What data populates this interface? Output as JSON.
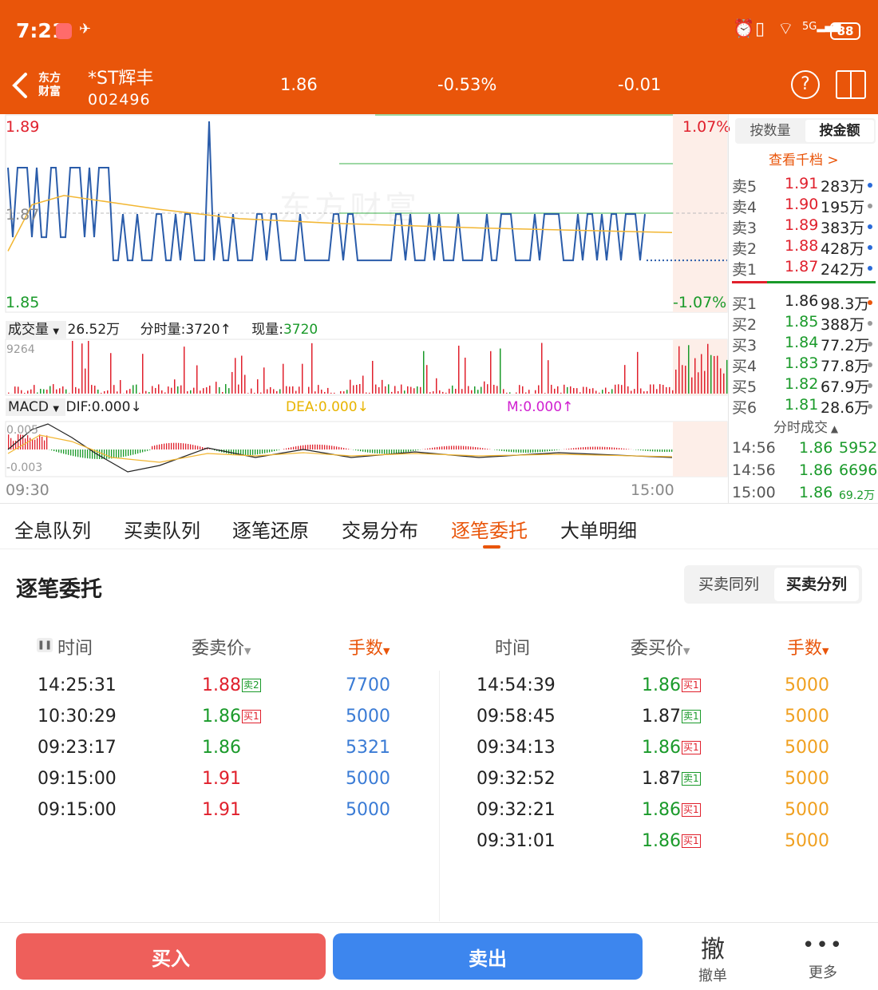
{
  "status_bar": {
    "time": "7:21",
    "battery": "88",
    "signal_label": "5G"
  },
  "header": {
    "logo_line1": "东方",
    "logo_line2": "财富",
    "stock_name": "*ST辉丰",
    "stock_code": "002496",
    "price": "1.86",
    "change_pct": "-0.53%",
    "change": "-0.01"
  },
  "chart": {
    "price_high": "1.89",
    "price_mid": "1.87",
    "price_low": "1.85",
    "pct_high": "1.07%",
    "pct_low": "-1.07%",
    "watermark": "东方财富",
    "volume_selector": "成交量",
    "volume_total": "26.52万",
    "period_volume_label": "分时量:3720",
    "current_volume_label": "现量:",
    "current_volume_value": "3720",
    "volume_axis_max": "9264",
    "macd_selector": "MACD",
    "dif": "DIF:0.000",
    "dea": "DEA:0.000",
    "m": "M:0.000",
    "macd_axis_top": "0.005",
    "macd_axis_bottom": "-0.003",
    "time_start": "09:30",
    "time_end": "15:00",
    "colors": {
      "price_line": "#2a5caa",
      "avg_line": "#f2b632",
      "up": "#e0202c",
      "down": "#1a9a2a"
    }
  },
  "order_book": {
    "toggle_qty": "按数量",
    "toggle_amount": "按金额",
    "view_depth": "查看千档 >",
    "asks": [
      {
        "label": "卖5",
        "price": "1.91",
        "amount": "283万",
        "dot": "#2a6ad8"
      },
      {
        "label": "卖4",
        "price": "1.90",
        "amount": "195万",
        "dot": "#999999"
      },
      {
        "label": "卖3",
        "price": "1.89",
        "amount": "383万",
        "dot": "#2a6ad8"
      },
      {
        "label": "卖2",
        "price": "1.88",
        "amount": "428万",
        "dot": "#2a6ad8"
      },
      {
        "label": "卖1",
        "price": "1.87",
        "amount": "242万",
        "dot": "#2a6ad8"
      }
    ],
    "bids": [
      {
        "label": "买1",
        "price": "1.86",
        "amount": "98.3万",
        "dot": "#e9550a"
      },
      {
        "label": "买2",
        "price": "1.85",
        "amount": "388万",
        "dot": "#999999"
      },
      {
        "label": "买3",
        "price": "1.84",
        "amount": "77.2万",
        "dot": "#999999"
      },
      {
        "label": "买4",
        "price": "1.83",
        "amount": "77.8万",
        "dot": "#999999"
      },
      {
        "label": "买5",
        "price": "1.82",
        "amount": "67.9万",
        "dot": "#999999"
      },
      {
        "label": "买6",
        "price": "1.81",
        "amount": "28.6万",
        "dot": "#999999"
      }
    ],
    "ticks_header": "分时成交",
    "ticks": [
      {
        "time": "14:56",
        "price": "1.86",
        "volume": "5952"
      },
      {
        "time": "14:56",
        "price": "1.86",
        "volume": "6696"
      },
      {
        "time": "15:00",
        "price": "1.86",
        "volume": "69.2万"
      }
    ]
  },
  "tabs": [
    "全息队列",
    "买卖队列",
    "逐笔还原",
    "交易分布",
    "逐笔委托",
    "大单明细"
  ],
  "active_tab": 4,
  "detail": {
    "title": "逐笔委托",
    "seg_same": "买卖同列",
    "seg_split": "买卖分列",
    "sell_headers": {
      "time": "时间",
      "price": "委卖价",
      "qty": "手数"
    },
    "buy_headers": {
      "time": "时间",
      "price": "委买价",
      "qty": "手数"
    },
    "sell_rows": [
      {
        "time": "14:25:31",
        "price": "1.88",
        "tag": "卖2",
        "qty": "7700",
        "color": "#e0202c",
        "tag_color": "#1a9a2a"
      },
      {
        "time": "10:30:29",
        "price": "1.86",
        "tag": "买1",
        "qty": "5000",
        "color": "#1a9a2a",
        "tag_color": "#e0202c"
      },
      {
        "time": "09:23:17",
        "price": "1.86",
        "tag": "",
        "qty": "5321",
        "color": "#1a9a2a",
        "tag_color": ""
      },
      {
        "time": "09:15:00",
        "price": "1.91",
        "tag": "",
        "qty": "5000",
        "color": "#e0202c",
        "tag_color": ""
      },
      {
        "time": "09:15:00",
        "price": "1.91",
        "tag": "",
        "qty": "5000",
        "color": "#e0202c",
        "tag_color": ""
      }
    ],
    "buy_rows": [
      {
        "time": "14:54:39",
        "price": "1.86",
        "tag": "买1",
        "qty": "5000",
        "color": "#1a9a2a",
        "tag_color": "#e0202c"
      },
      {
        "time": "09:58:45",
        "price": "1.87",
        "tag": "卖1",
        "qty": "5000",
        "color": "#222222",
        "tag_color": "#1a9a2a"
      },
      {
        "time": "09:34:13",
        "price": "1.86",
        "tag": "买1",
        "qty": "5000",
        "color": "#1a9a2a",
        "tag_color": "#e0202c"
      },
      {
        "time": "09:32:52",
        "price": "1.87",
        "tag": "卖1",
        "qty": "5000",
        "color": "#222222",
        "tag_color": "#1a9a2a"
      },
      {
        "time": "09:32:21",
        "price": "1.86",
        "tag": "买1",
        "qty": "5000",
        "color": "#1a9a2a",
        "tag_color": "#e0202c"
      },
      {
        "time": "09:31:01",
        "price": "1.86",
        "tag": "买1",
        "qty": "5000",
        "color": "#1a9a2a",
        "tag_color": "#e0202c"
      }
    ]
  },
  "bottom_bar": {
    "buy": "买入",
    "sell": "卖出",
    "cancel_icon_char": "撤",
    "cancel": "撤单",
    "more": "更多"
  }
}
